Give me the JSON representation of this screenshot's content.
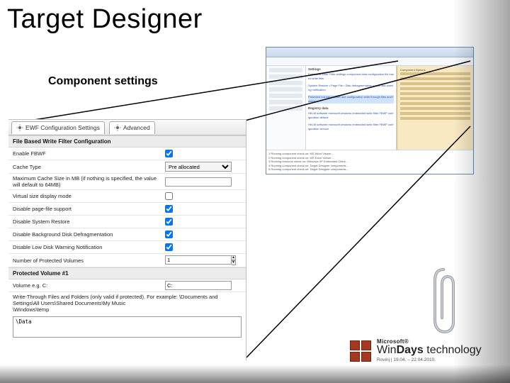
{
  "title": "Target Designer",
  "subtitle": "Component settings",
  "ide": {
    "left_items": [
      "",
      "",
      "",
      "",
      "",
      "",
      ""
    ],
    "mid_heading_1": "Settings",
    "mid_heading_2": "Registry data",
    "right_heading": "Component Options",
    "bottom_lines": [
      "1  Running component check on: MS Word Viewer…",
      "2  Running component check on: MS Excel Viewer…",
      "3  Running resource check on: Windows XP Embedded Client…",
      "4  Running component check on: Target Designer components…",
      "5  Running component check on: Target Designer components…"
    ]
  },
  "panel": {
    "tabs": [
      {
        "label": "EWF Configuration Settings"
      },
      {
        "label": "Advanced"
      }
    ],
    "section1": "File Based Write Filter Configuration",
    "rows": [
      {
        "label": "Enable FBWF",
        "type": "check",
        "checked": true
      },
      {
        "label": "Cache Type",
        "type": "select",
        "value": "Pre allocated"
      },
      {
        "label": "Maximum Cache Size in MB (if nothing is specified, the value will default to 64MB)",
        "type": "text",
        "value": ""
      },
      {
        "label": "Virtual size display mode",
        "type": "check",
        "checked": false
      },
      {
        "label": "Disable page-file support",
        "type": "check",
        "checked": true
      },
      {
        "label": "Disable System Restore",
        "type": "check",
        "checked": true
      },
      {
        "label": "Disable Background Disk Defragmentation",
        "type": "check",
        "checked": true
      },
      {
        "label": "Disable Low Disk Warning Notification",
        "type": "check",
        "checked": true
      },
      {
        "label": "Number of Protected Volumes",
        "type": "spin",
        "value": "1"
      }
    ],
    "section2": "Protected Volume #1",
    "vol_row": {
      "label": "Volume  e.g. C:",
      "value": "C:"
    },
    "writethru_label": "Write-Through Files and Folders (only valid if protected). For example: \\Documents and Settings\\All Users\\Shared Documents\\My Music\n\\Windows\\temp",
    "writethru_value": "\\Data"
  },
  "logo": {
    "ms": "Microsoft®",
    "brand_a": "Win",
    "brand_b": "Days",
    "tag": "technology",
    "sub": "Rovinj | 19.04. – 22.04.2010."
  }
}
